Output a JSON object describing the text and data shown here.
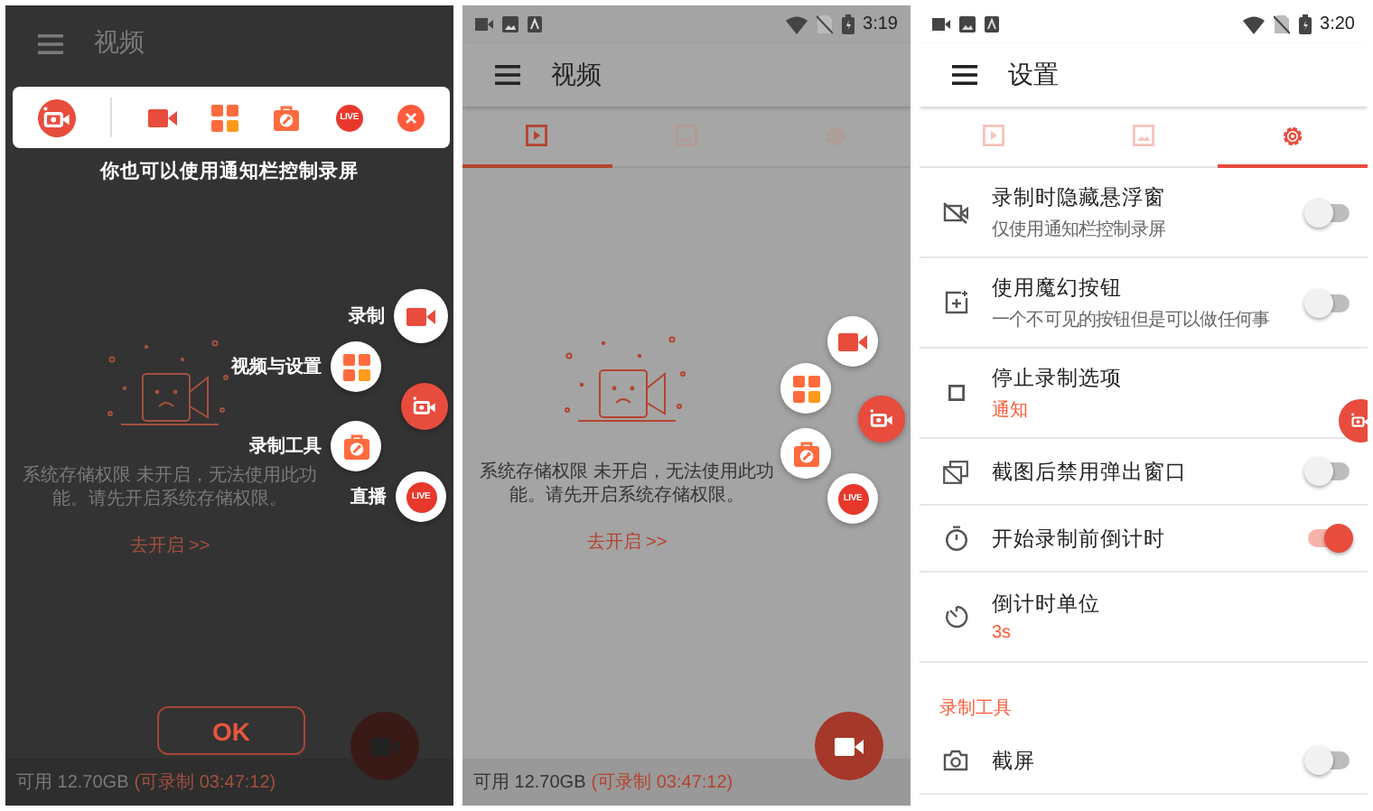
{
  "tutorial_screen": {
    "app_bar": {
      "title": "视频"
    },
    "notification_toolbar": {
      "live_badge": "LIVE"
    },
    "hint": "你也可以使用通知栏控制录屏",
    "floating_menu": [
      {
        "label": "录制"
      },
      {
        "label": "视频与设置"
      },
      {
        "label": "录制工具"
      },
      {
        "label": "直播",
        "badge": "LIVE"
      }
    ],
    "empty_state": {
      "message": "系统存储权限 未开启，无法使用此功能。请先开启系统存储权限。",
      "link": "去开启 >>"
    },
    "ok_button": "OK",
    "storage": {
      "available": "可用 12.70GB",
      "record_time": "(可录制 03:47:12)"
    }
  },
  "videos_screen": {
    "status_bar": {
      "time": "3:19"
    },
    "app_bar": {
      "title": "视频"
    },
    "tabs": [
      {
        "selected": true
      },
      {
        "selected": false
      },
      {
        "selected": false
      }
    ],
    "empty_state": {
      "message": "系统存储权限 未开启，无法使用此功能。请先开启系统存储权限。",
      "link": "去开启 >>"
    },
    "floating_menu": {
      "live_badge": "LIVE"
    },
    "storage": {
      "available": "可用 12.70GB",
      "record_time": "(可录制 03:47:12)"
    }
  },
  "settings_screen": {
    "status_bar": {
      "time": "3:20"
    },
    "app_bar": {
      "title": "设置"
    },
    "tabs": [
      {
        "selected": false
      },
      {
        "selected": false
      },
      {
        "selected": true
      }
    ],
    "settings": [
      {
        "kind": "toggle",
        "title": "录制时隐藏悬浮窗",
        "subtitle": "仅使用通知栏控制录屏",
        "on": false
      },
      {
        "kind": "toggle",
        "title": "使用魔幻按钮",
        "subtitle": "一个不可见的按钮但是可以做任何事",
        "on": false
      },
      {
        "kind": "option",
        "title": "停止录制选项",
        "value": "通知"
      },
      {
        "kind": "toggle",
        "title": "截图后禁用弹出窗口",
        "on": false
      },
      {
        "kind": "toggle",
        "title": "开始录制前倒计时",
        "on": true
      },
      {
        "kind": "option",
        "title": "倒计时单位",
        "value": "3s"
      },
      {
        "kind": "header",
        "title": "录制工具"
      },
      {
        "kind": "toggle",
        "title": "截屏",
        "on": false
      }
    ]
  }
}
